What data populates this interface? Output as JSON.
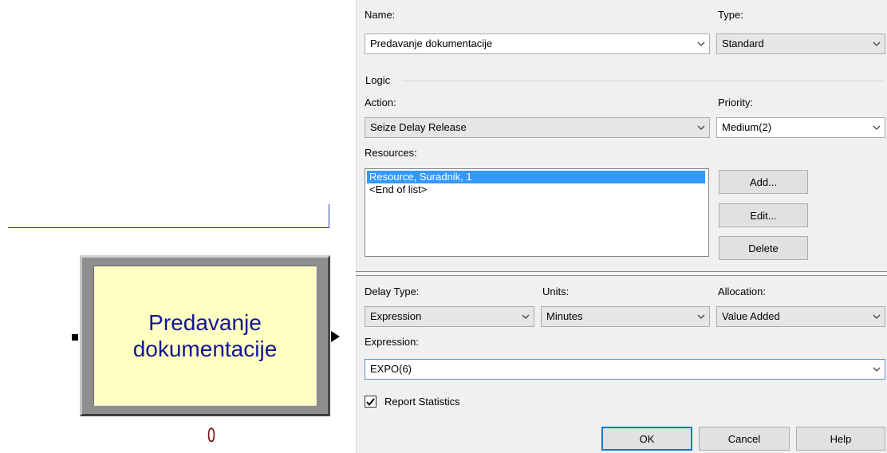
{
  "canvas": {
    "module_label": "Predavanje\ndokumentacije",
    "module_count": "0",
    "module_fill": "#ffffc4",
    "label_color": "#141694",
    "connector_color": "#2c3aa0"
  },
  "dialog": {
    "name": {
      "label": "Name:",
      "value": "Predavanje dokumentacije"
    },
    "type": {
      "label": "Type:",
      "value": "Standard"
    },
    "logic_group": "Logic",
    "action": {
      "label": "Action:",
      "value": "Seize Delay Release"
    },
    "priority": {
      "label": "Priority:",
      "value": "Medium(2)"
    },
    "resources": {
      "label": "Resources:",
      "items": [
        "Resource, Suradnik, 1",
        "<End of list>"
      ],
      "selected_index": 0
    },
    "resource_buttons": {
      "add": "Add...",
      "edit": "Edit...",
      "delete": "Delete"
    },
    "delay_type": {
      "label": "Delay Type:",
      "value": "Expression"
    },
    "units": {
      "label": "Units:",
      "value": "Minutes"
    },
    "allocation": {
      "label": "Allocation:",
      "value": "Value Added"
    },
    "expression": {
      "label": "Expression:",
      "value": "EXPO(6)"
    },
    "report_statistics": {
      "label": "Report Statistics",
      "checked": true
    },
    "buttons": {
      "ok": "OK",
      "cancel": "Cancel",
      "help": "Help"
    },
    "selection_color": "#3399ff",
    "focus_border_color": "#5a8fd0"
  }
}
